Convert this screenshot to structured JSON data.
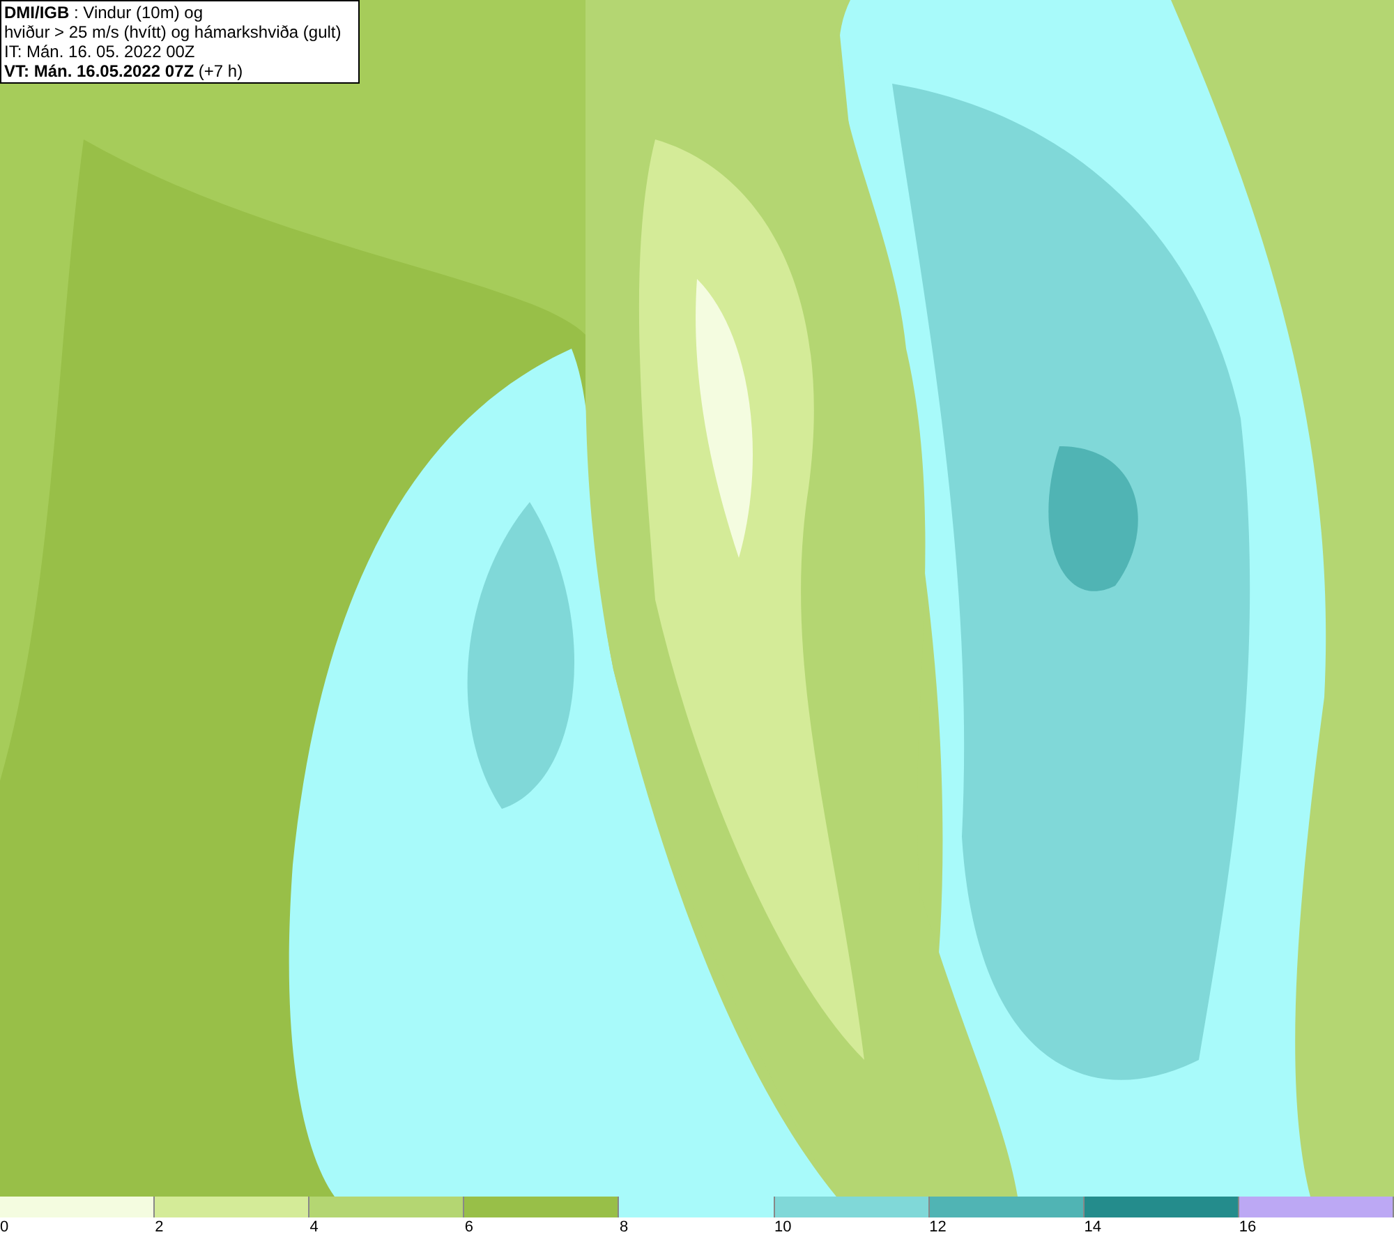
{
  "header": {
    "lines": [
      "**DMI/IGB** : Vindur (10m) og",
      "hviður > 25 m/s (hvítt) og hámarkshviða (gult)",
      "IT: Mán. 16. 05. 2022 00Z",
      "**VT: Mán. 16.05.2022 07Z** (+7 h)"
    ]
  },
  "legend": [
    {
      "tick": "0",
      "color": "#f4fce0"
    },
    {
      "tick": "2",
      "color": "#d4eb98"
    },
    {
      "tick": "4",
      "color": "#b4d672"
    },
    {
      "tick": "6",
      "color": "#98bf48"
    },
    {
      "tick": "8",
      "color": "#a8fafa"
    },
    {
      "tick": "10",
      "color": "#80d8d8"
    },
    {
      "tick": "12",
      "color": "#50b4b4"
    },
    {
      "tick": "14",
      "color": "#248c8c"
    },
    {
      "tick": "16",
      "color": "#bca8f4"
    }
  ]
}
